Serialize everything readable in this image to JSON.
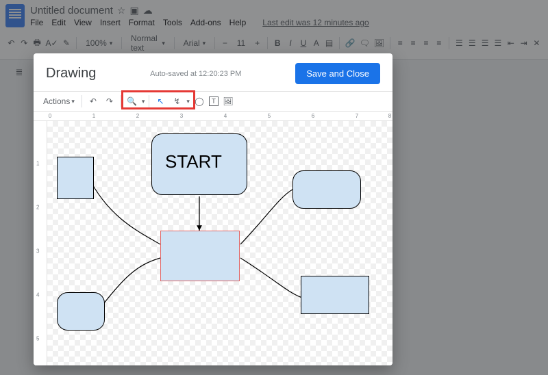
{
  "doc": {
    "title": "Untitled document",
    "menus": [
      "File",
      "Edit",
      "View",
      "Insert",
      "Format",
      "Tools",
      "Add-ons",
      "Help"
    ],
    "last_edit": "Last edit was 12 minutes ago"
  },
  "main_toolbar": {
    "zoom": "100%",
    "paragraph_style": "Normal text",
    "font": "Arial",
    "font_size": "11"
  },
  "dialog": {
    "title": "Drawing",
    "autosave": "Auto-saved at 12:20:23 PM",
    "save_label": "Save and Close",
    "actions_label": "Actions",
    "ruler_marks": [
      "0",
      "1",
      "2",
      "3",
      "4",
      "5",
      "6",
      "7",
      "8"
    ],
    "vruler_marks": [
      "1",
      "2",
      "3",
      "4",
      "5"
    ]
  },
  "drawing": {
    "start_label": "START"
  },
  "icons": {
    "star": "☆",
    "move": "▣",
    "cloud": "☁",
    "undo": "↶",
    "redo": "↷",
    "print": "🖶",
    "spell": "A✓",
    "paint": "✎",
    "minus": "−",
    "plus": "+",
    "bold": "B",
    "italic": "I",
    "underline": "U",
    "textcolor": "A",
    "highlight": "▤",
    "link": "🔗",
    "comment": "🗨",
    "image": "🖼",
    "align": "≡",
    "line": "☰",
    "list1": "☰",
    "list2": "☰",
    "list3": "☰",
    "indent_dec": "⇤",
    "indent_inc": "⇥",
    "clear": "✕",
    "outline": "≣",
    "caret": "▾",
    "select": "↖",
    "connector": "↯",
    "shape": "◯",
    "textbox": "T",
    "img": "🖼",
    "zoom": "🔍"
  }
}
